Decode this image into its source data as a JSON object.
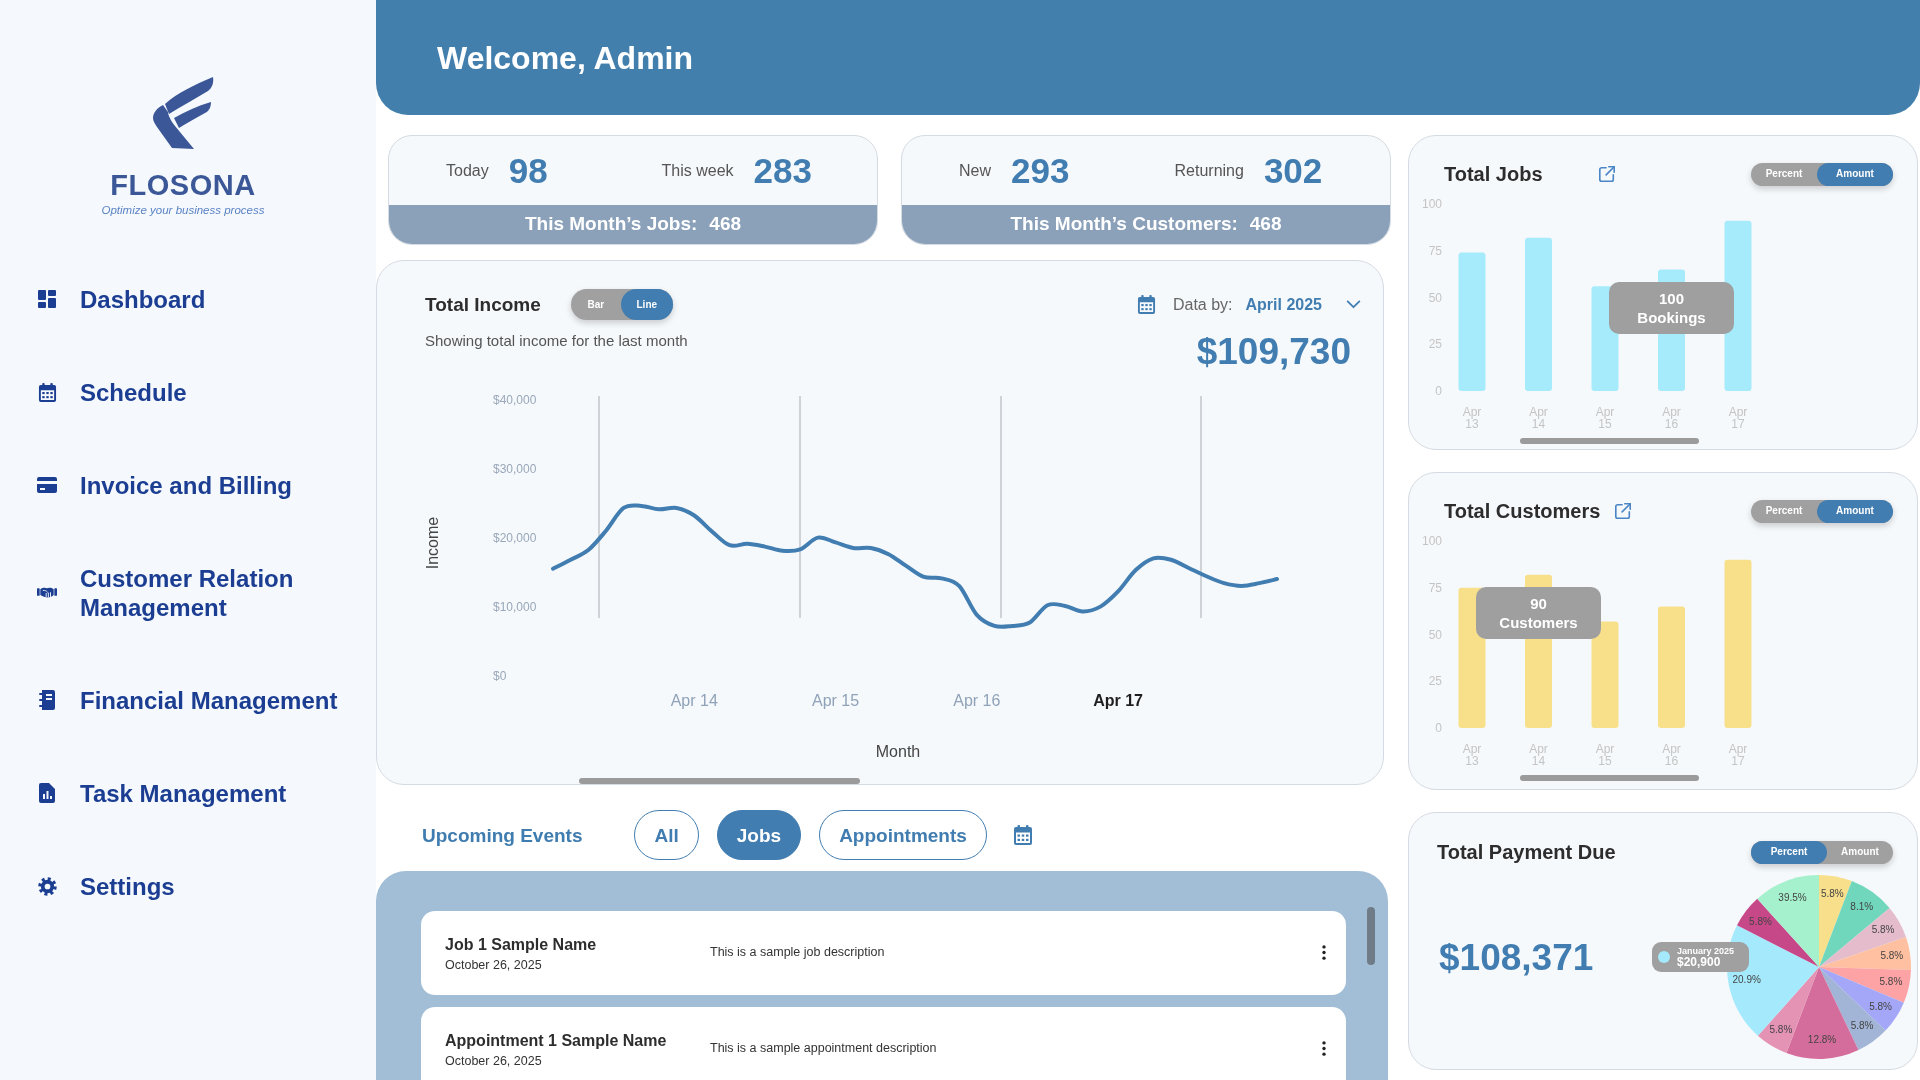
{
  "sidebar": {
    "logo": {
      "name": "FLOSONA",
      "tagline": "Optimize your business process"
    },
    "items": [
      {
        "label": "Dashboard"
      },
      {
        "label": "Schedule"
      },
      {
        "label": "Invoice and Billing"
      },
      {
        "label": "Customer Relation Management"
      },
      {
        "label": "Financial Management"
      },
      {
        "label": "Task Management"
      },
      {
        "label": "Settings"
      }
    ]
  },
  "header": {
    "title": "Welcome, Admin"
  },
  "stat_cards": [
    {
      "stats": [
        {
          "label": "Today",
          "value": "98"
        },
        {
          "label": "This week",
          "value": "283"
        }
      ],
      "summary": {
        "label": "This Month’s Jobs:",
        "value": "468"
      }
    },
    {
      "stats": [
        {
          "label": "New",
          "value": "293"
        },
        {
          "label": "Returning",
          "value": "302"
        }
      ],
      "summary": {
        "label": "This Month’s Customers:",
        "value": "468"
      }
    }
  ],
  "income": {
    "title": "Total Income",
    "toggle": [
      {
        "label": "Bar",
        "selected": false
      },
      {
        "label": "Line",
        "selected": true
      }
    ],
    "subtitle": "Showing total income for the last month",
    "filter": {
      "label": "Data by:",
      "value": "April 2025"
    },
    "total": "$109,730",
    "chart_data": {
      "type": "line",
      "xlabel": "Month",
      "ylabel": "Income",
      "categories": [
        null,
        null,
        null,
        null,
        null,
        null,
        null,
        null,
        "Apr 14",
        null,
        null,
        null,
        null,
        null,
        null,
        null,
        "Apr 15",
        null,
        null,
        null,
        null,
        null,
        null,
        null,
        "Apr 16",
        null,
        null,
        null,
        null,
        null,
        null,
        null,
        "Apr 17",
        null,
        null,
        null,
        null,
        null,
        null,
        null,
        null,
        null
      ],
      "series": [
        {
          "color": "#417db0",
          "values": [
            15700,
            17000,
            18400,
            21200,
            24500,
            24800,
            24300,
            24500,
            23400,
            21100,
            19100,
            19300,
            18900,
            18300,
            18500,
            20200,
            19500,
            18700,
            18700,
            17800,
            16100,
            14500,
            14300,
            13200,
            9000,
            7400,
            7400,
            7900,
            10400,
            10300,
            9500,
            10200,
            12400,
            15500,
            17200,
            17000,
            15800,
            14600,
            13600,
            13200,
            13600,
            14200
          ]
        }
      ],
      "ylim": [
        0,
        40000
      ],
      "yticks": [
        {
          "value": 0,
          "label": "$0"
        },
        {
          "value": 10000,
          "label": "$10,000"
        },
        {
          "value": 20000,
          "label": "$20,000"
        },
        {
          "value": 30000,
          "label": "$30,000"
        },
        {
          "value": 40000,
          "label": "$40,000"
        }
      ]
    },
    "x_ticks": [
      {
        "selected": false
      },
      {
        "selected": false
      },
      {
        "selected": false
      },
      {
        "selected": true
      }
    ]
  },
  "events": {
    "title": "Upcoming Events",
    "filters": [
      {
        "label": "All",
        "selected": false
      },
      {
        "label": "Jobs",
        "selected": true
      },
      {
        "label": "Appointments",
        "selected": false
      }
    ],
    "items": [
      {
        "name": "Job 1 Sample Name",
        "date": "October 26, 2025",
        "description": "This is a sample job description"
      },
      {
        "name": "Appointment 1 Sample Name",
        "date": "October 26, 2025",
        "description": "This is a sample appointment description"
      }
    ]
  },
  "total_jobs": {
    "title": "Total Jobs",
    "toggle": [
      {
        "label": "Percent",
        "selected": false
      },
      {
        "label": "Amount",
        "selected": true
      }
    ],
    "chart_data": {
      "type": "bar",
      "categories": [
        "Apr 13",
        "Apr 14",
        "Apr 15",
        "Apr 16",
        "Apr 17"
      ],
      "series": [
        {
          "color": "#a6ebfb",
          "values": [
            74,
            82,
            56,
            65,
            91
          ]
        }
      ],
      "ylim": [
        0,
        100
      ],
      "yticks": [
        0,
        25,
        50,
        75,
        100
      ],
      "annotations": [
        "100 Bookings"
      ]
    }
  },
  "total_customers": {
    "title": "Total Customers",
    "toggle": [
      {
        "label": "Percent",
        "selected": false
      },
      {
        "label": "Amount",
        "selected": true
      }
    ],
    "chart_data": {
      "type": "bar",
      "categories": [
        "Apr 13",
        "Apr 14",
        "Apr 15",
        "Apr 16",
        "Apr 17"
      ],
      "series": [
        {
          "color": "#f8e08b",
          "values": [
            75,
            82,
            57,
            65,
            90
          ]
        }
      ],
      "ylim": [
        0,
        100
      ],
      "yticks": [
        0,
        25,
        50,
        75,
        100
      ],
      "annotations": [
        "90 Customers"
      ]
    }
  },
  "total_payment_due": {
    "title": "Total Payment Due",
    "toggle": [
      {
        "label": "Percent",
        "selected": true
      },
      {
        "label": "Amount",
        "selected": false
      }
    ],
    "total": "$108,371",
    "chart_data": {
      "type": "pie",
      "values": [
        5.8,
        8.1,
        5.8,
        5.8,
        5.8,
        5.8,
        5.8,
        12.8,
        5.8,
        20.9,
        5.8,
        11.7
      ],
      "colors": [
        "#f8df8b",
        "#70d7bd",
        "#e4bccc",
        "#fec0a0",
        "#fea3a5",
        "#a4a7f7",
        "#a2b5d6",
        "#d56d9c",
        "#e493b4",
        "#a5eafc",
        "#c64889",
        "#a6f1cd"
      ]
    },
    "slice_labels": [
      "5.8%",
      "8.1%",
      "5.8%",
      "5.8%",
      "5.8%",
      "5.8%",
      "5.8%",
      "12.8%",
      "5.8%",
      "20.9%",
      "5.8%",
      "39.5%"
    ],
    "tooltip": {
      "title": "January 2025",
      "value": "$20,900",
      "color": "#a5eafc"
    }
  }
}
